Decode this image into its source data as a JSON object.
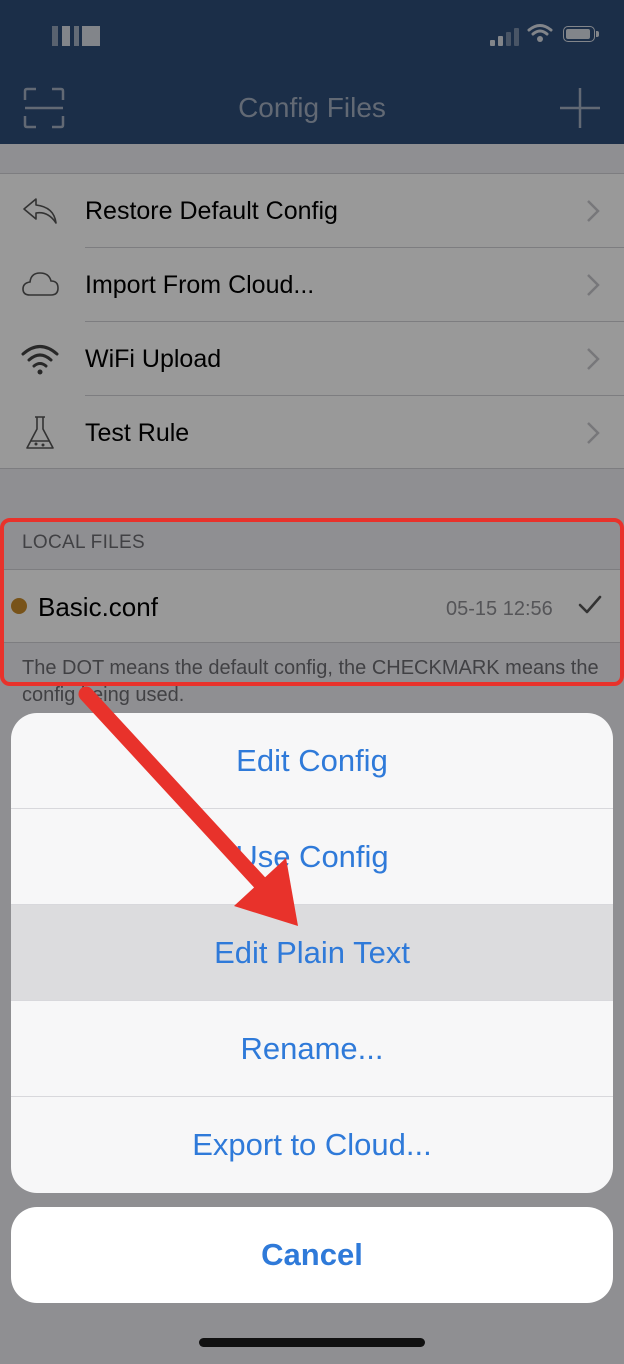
{
  "nav": {
    "title": "Config Files",
    "left_icon": "scan-icon",
    "right_icon": "plus-icon"
  },
  "menu": {
    "items": [
      {
        "label": "Restore Default Config",
        "icon": "undo-icon"
      },
      {
        "label": "Import From Cloud...",
        "icon": "cloud-icon"
      },
      {
        "label": "WiFi Upload",
        "icon": "wifi-icon"
      },
      {
        "label": "Test Rule",
        "icon": "flask-icon"
      }
    ]
  },
  "local_files": {
    "header": "LOCAL FILES",
    "files": [
      {
        "name": "Basic.conf",
        "time": "05-15 12:56",
        "default_dot_color": "#c88b2a",
        "in_use": true
      }
    ],
    "footnote": "The DOT means the default config, the CHECKMARK means the config being used."
  },
  "action_sheet": {
    "actions": [
      {
        "label": "Edit Config"
      },
      {
        "label": "Use Config"
      },
      {
        "label": "Edit Plain Text",
        "pressed": true
      },
      {
        "label": "Rename..."
      },
      {
        "label": "Export to Cloud..."
      }
    ],
    "cancel_label": "Cancel"
  },
  "colors": {
    "nav_background": "#2e4d78",
    "action_text": "#2f7ad9",
    "annotation_red": "#e8322b"
  }
}
